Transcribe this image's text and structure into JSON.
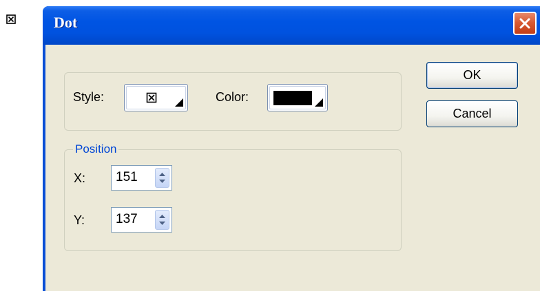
{
  "desktop": {
    "marker_icon": "boxed-x-icon"
  },
  "window": {
    "title": "Dot",
    "close_icon": "close-icon",
    "title_color": "#0054e3",
    "close_color": "#d85a34"
  },
  "style_group": {
    "style_label": "Style:",
    "style_value_icon": "boxed-x-icon",
    "color_label": "Color:",
    "color_value": "#000000"
  },
  "position_group": {
    "legend": "Position",
    "legend_color": "#0046d5",
    "x_label": "X:",
    "x_value": "151",
    "y_label": "Y:",
    "y_value": "137"
  },
  "buttons": {
    "ok_label": "OK",
    "cancel_label": "Cancel"
  }
}
